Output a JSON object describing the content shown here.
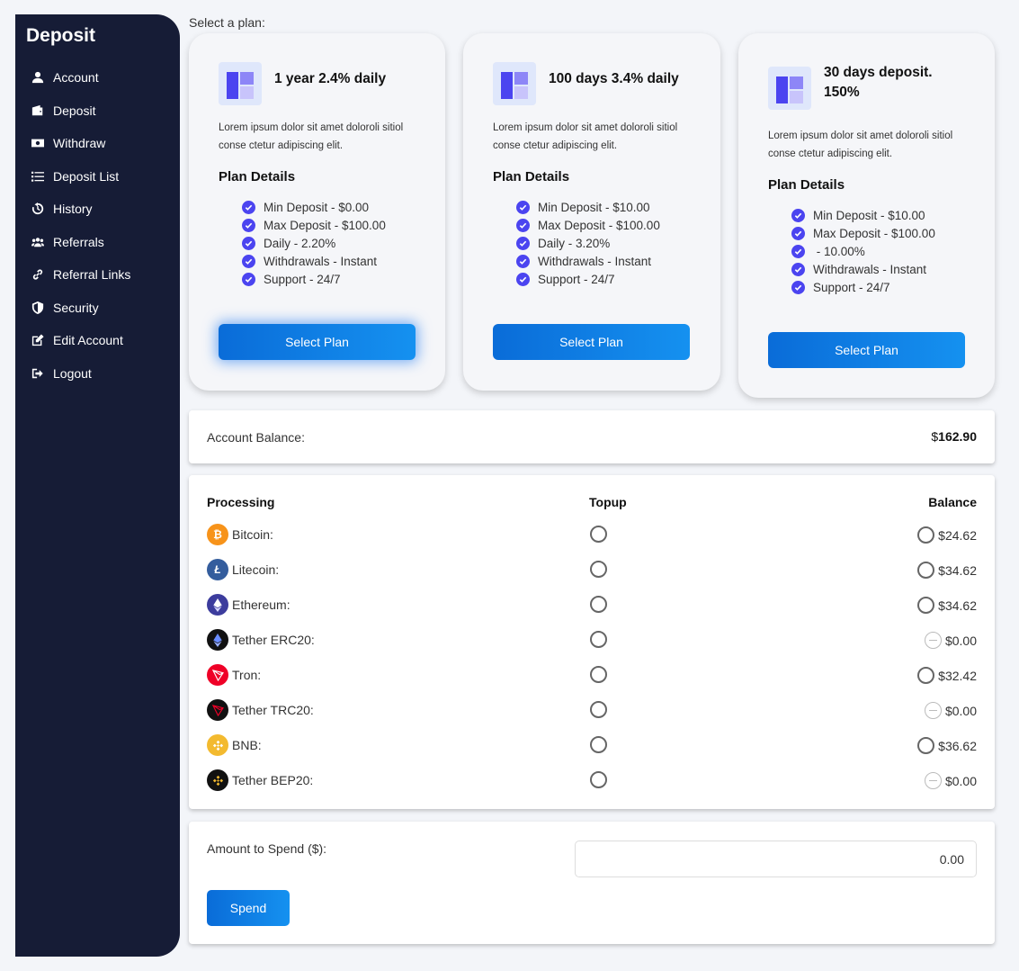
{
  "sidebar": {
    "title": "Deposit",
    "items": [
      {
        "label": "Account",
        "icon": "user-icon"
      },
      {
        "label": "Deposit",
        "icon": "wallet-icon"
      },
      {
        "label": "Withdraw",
        "icon": "money-bill-icon"
      },
      {
        "label": "Deposit List",
        "icon": "list-icon"
      },
      {
        "label": "History",
        "icon": "history-icon"
      },
      {
        "label": "Referrals",
        "icon": "users-icon"
      },
      {
        "label": "Referral Links",
        "icon": "link-icon"
      },
      {
        "label": "Security",
        "icon": "shield-icon"
      },
      {
        "label": "Edit Account",
        "icon": "edit-icon"
      },
      {
        "label": "Logout",
        "icon": "logout-icon"
      }
    ]
  },
  "plans_label": "Select a plan:",
  "plans": [
    {
      "title": "1 year 2.4% daily",
      "description": "Lorem ipsum dolor sit amet doloroli sitiol conse ctetur adipiscing elit.",
      "details_heading": "Plan Details",
      "features": [
        "Min Deposit - $0.00",
        "Max Deposit - $100.00",
        "Daily - 2.20%",
        "Withdrawals - Instant",
        "Support - 24/7"
      ],
      "button": "Select Plan"
    },
    {
      "title": "100 days 3.4% daily",
      "description": "Lorem ipsum dolor sit amet doloroli sitiol conse ctetur adipiscing elit.",
      "details_heading": "Plan Details",
      "features": [
        "Min Deposit - $10.00",
        "Max Deposit - $100.00",
        "Daily - 3.20%",
        "Withdrawals - Instant",
        "Support - 24/7"
      ],
      "button": "Select Plan"
    },
    {
      "title_line1": "30 days deposit.",
      "title_line2": "150%",
      "description": "Lorem ipsum dolor sit amet doloroli sitiol conse ctetur adipiscing elit.",
      "details_heading": "Plan Details",
      "features": [
        "Min Deposit - $10.00",
        "Max Deposit - $100.00",
        " - 10.00%",
        "Withdrawals - Instant",
        "Support - 24/7"
      ],
      "button": "Select Plan"
    }
  ],
  "account": {
    "label": "Account Balance:",
    "currency": "$",
    "amount": "162.90"
  },
  "processing": {
    "headers": {
      "processing": "Processing",
      "topup": "Topup",
      "balance": "Balance"
    },
    "rows": [
      {
        "name": "Bitcoin:",
        "icon": "bitcoin-icon",
        "color": "#f7931a",
        "balance": "$24.62",
        "enabled": true
      },
      {
        "name": "Litecoin:",
        "icon": "litecoin-icon",
        "color": "#345d9d",
        "balance": "$34.62",
        "enabled": true
      },
      {
        "name": "Ethereum:",
        "icon": "ethereum-icon",
        "color": "#3c3c9d",
        "balance": "$34.62",
        "enabled": true
      },
      {
        "name": "Tether ERC20:",
        "icon": "tether-erc20-icon",
        "color": "#111111",
        "balance": "$0.00",
        "enabled": false
      },
      {
        "name": "Tron:",
        "icon": "tron-icon",
        "color": "#ef0027",
        "balance": "$32.42",
        "enabled": true
      },
      {
        "name": "Tether TRC20:",
        "icon": "tether-trc20-icon",
        "color": "#111111",
        "balance": "$0.00",
        "enabled": false
      },
      {
        "name": "BNB:",
        "icon": "bnb-icon",
        "color": "#f3ba2f",
        "balance": "$36.62",
        "enabled": true
      },
      {
        "name": "Tether BEP20:",
        "icon": "tether-bep20-icon",
        "color": "#111111",
        "balance": "$0.00",
        "enabled": false
      }
    ]
  },
  "spend": {
    "label": "Amount to Spend ($):",
    "value": "0.00",
    "button": "Spend"
  },
  "colors": {
    "sidebar": "#161c36",
    "accent": "#4b44f0",
    "button": "#0a6cd8"
  }
}
